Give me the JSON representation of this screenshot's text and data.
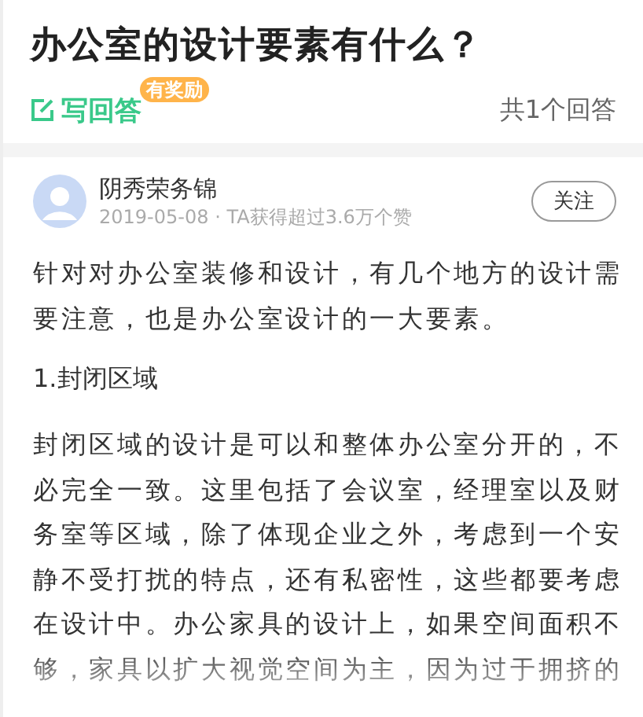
{
  "question": {
    "title": "办公室的设计要素有什么？"
  },
  "actions": {
    "write_answer": "写回答",
    "reward_badge": "有奖励",
    "answer_count": "共1个回答"
  },
  "answer": {
    "author": "阴秀荣务锦",
    "date": "2019-05-08",
    "separator": "·",
    "meta": "TA获得超过3.6万个赞",
    "follow_button": "关注",
    "blocks": [
      {
        "kind": "paragraph",
        "text": "针对对办公室装修和设计，有几个地方的设计需要注意，也是办公室设计的一大要素。"
      },
      {
        "kind": "heading",
        "text": "1.封闭区域"
      },
      {
        "kind": "paragraph",
        "text": "封闭区域的设计是可以和整体办公室分开的，不必完全一致。这里包括了会议室，经理室以及财务室等区域，除了体现企业之外，考虑到一个安静不受打扰的特点，还有私密性，这些都要考虑在设计中。办公家具的设计上，如果空间面积不够，家具以扩大视觉空间为主，因为过于拥挤的"
      }
    ]
  }
}
